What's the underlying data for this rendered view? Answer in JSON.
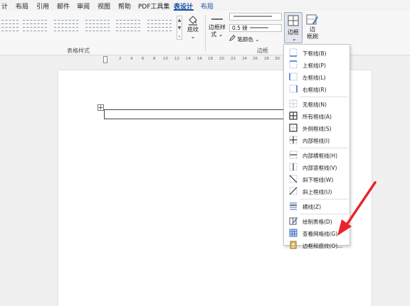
{
  "menubar": {
    "items": [
      "计",
      "布局",
      "引用",
      "邮件",
      "审阅",
      "视图",
      "帮助",
      "PDF工具集",
      "表设计",
      "布局"
    ]
  },
  "ribbon": {
    "table_styles_group_label": "表格样式",
    "borders_group_label": "边框",
    "shading_label": "底纹",
    "shading_arrow": "⌄",
    "border_styles_label": "边框样",
    "border_styles_label2": "式",
    "pen_weight": "0.5 磅",
    "pen_color_label": "笔颜色",
    "borders_button_label": "边框",
    "border_painter_label_1": "边",
    "border_painter_label_2": "框刷",
    "gallery_up": "▲",
    "gallery_down": "▼"
  },
  "ruler": {
    "ticks": [
      "2",
      "4",
      "6",
      "8",
      "10",
      "12",
      "14",
      "16",
      "18",
      "20",
      "22",
      "24",
      "26",
      "28",
      "30",
      "3"
    ]
  },
  "border_menu": {
    "items": [
      {
        "label": "下框线(B)",
        "icon": "bottom-border-icon"
      },
      {
        "label": "上框线(P)",
        "icon": "top-border-icon"
      },
      {
        "label": "左框线(L)",
        "icon": "left-border-icon"
      },
      {
        "label": "右框线(R)",
        "icon": "right-border-icon"
      },
      {
        "label": "无框线(N)",
        "icon": "no-border-icon"
      },
      {
        "label": "所有框线(A)",
        "icon": "all-borders-icon"
      },
      {
        "label": "外侧框线(S)",
        "icon": "outside-borders-icon"
      },
      {
        "label": "内部框线(I)",
        "icon": "inside-borders-icon"
      },
      {
        "label": "内部横框线(H)",
        "icon": "inside-horizontal-border-icon"
      },
      {
        "label": "内部竖框线(V)",
        "icon": "inside-vertical-border-icon"
      },
      {
        "label": "斜下框线(W)",
        "icon": "diagonal-down-border-icon"
      },
      {
        "label": "斜上框线(U)",
        "icon": "diagonal-up-border-icon"
      },
      {
        "label": "横线(Z)",
        "icon": "horizontal-line-icon"
      },
      {
        "label": "绘制表格(D)",
        "icon": "draw-table-icon"
      },
      {
        "label": "查看网格线(G)",
        "icon": "view-gridlines-icon"
      },
      {
        "label": "边框和底纹(O)...",
        "icon": "borders-and-shading-icon"
      }
    ]
  },
  "colors": {
    "accent": "#1b4fa8",
    "annotation_arrow": "#e8252a",
    "icon_blue": "#3c6fc4"
  }
}
